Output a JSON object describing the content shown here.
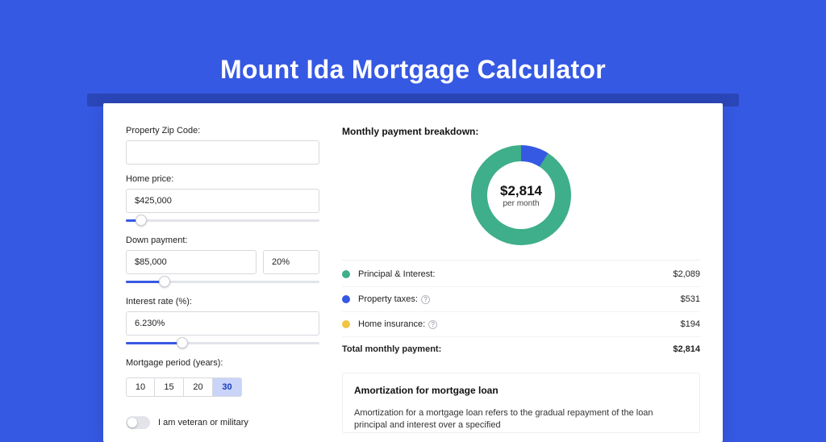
{
  "title": "Mount Ida Mortgage Calculator",
  "colors": {
    "principal": "#3fae8a",
    "tax": "#3659e3",
    "insurance": "#f1c542"
  },
  "form": {
    "zip_label": "Property Zip Code:",
    "zip_value": "",
    "price_label": "Home price:",
    "price_value": "$425,000",
    "price_slider_pct": 8,
    "down_label": "Down payment:",
    "down_value": "$85,000",
    "down_pct_value": "20%",
    "down_slider_pct": 20,
    "rate_label": "Interest rate (%):",
    "rate_value": "6.230%",
    "rate_slider_pct": 29,
    "period_label": "Mortgage period (years):",
    "period_options": [
      "10",
      "15",
      "20",
      "30"
    ],
    "period_selected": "30",
    "veteran_label": "I am veteran or military",
    "veteran_on": false
  },
  "breakdown": {
    "title": "Monthly payment breakdown:",
    "donut_amount": "$2,814",
    "donut_sub": "per month",
    "rows": [
      {
        "key": "principal",
        "label": "Principal & Interest:",
        "value": "$2,089",
        "color": "#3fae8a",
        "help": false
      },
      {
        "key": "tax",
        "label": "Property taxes:",
        "value": "$531",
        "color": "#3659e3",
        "help": true
      },
      {
        "key": "insurance",
        "label": "Home insurance:",
        "value": "$194",
        "color": "#f1c542",
        "help": true
      }
    ],
    "total_label": "Total monthly payment:",
    "total_value": "$2,814"
  },
  "chart_data": {
    "type": "pie",
    "title": "Monthly payment breakdown",
    "series": [
      {
        "name": "Principal & Interest",
        "value": 2089,
        "color": "#3fae8a"
      },
      {
        "name": "Property taxes",
        "value": 531,
        "color": "#3659e3"
      },
      {
        "name": "Home insurance",
        "value": 194,
        "color": "#f1c542"
      }
    ],
    "total": 2814
  },
  "amortization": {
    "title": "Amortization for mortgage loan",
    "text": "Amortization for a mortgage loan refers to the gradual repayment of the loan principal and interest over a specified"
  }
}
